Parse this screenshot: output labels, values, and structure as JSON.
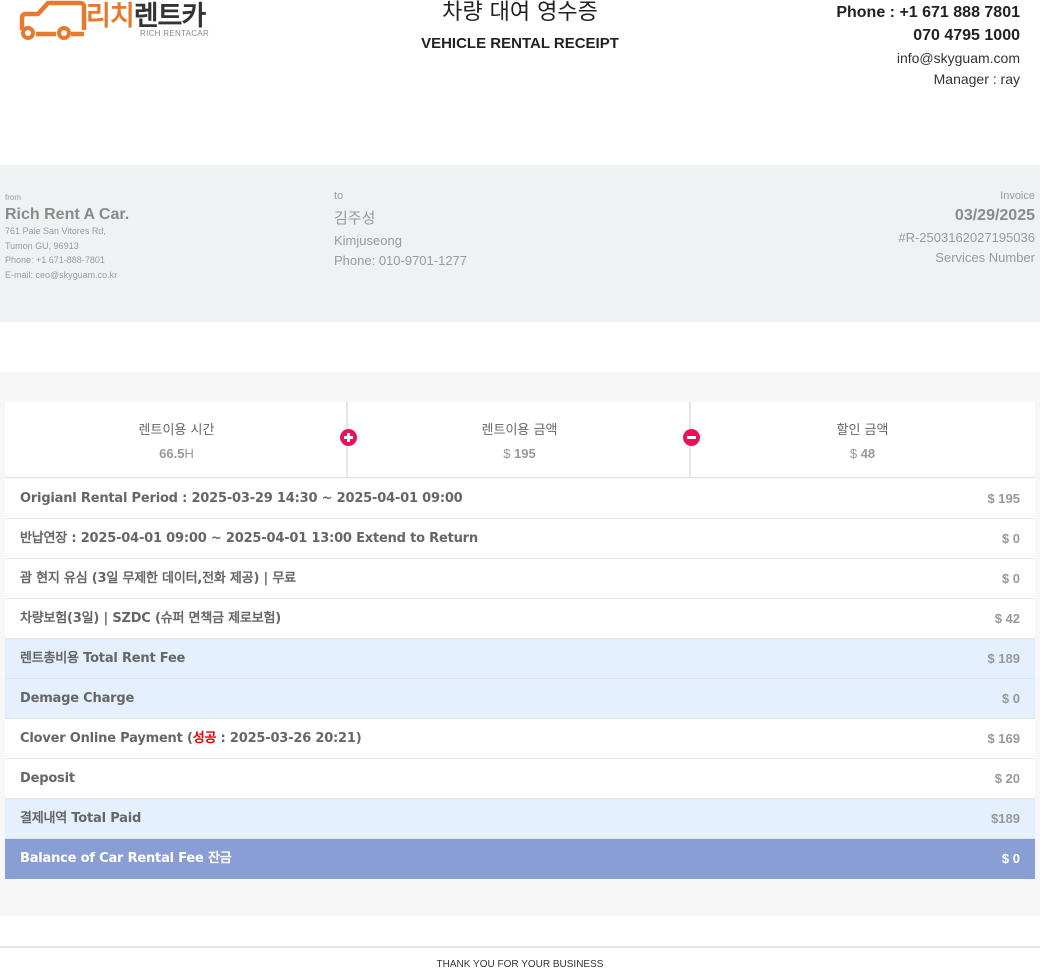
{
  "header": {
    "logo_kr_1": "리치",
    "logo_kr_2": "렌트카",
    "logo_en": "RICH RENTACAR",
    "brand_color": "#e8782b",
    "title_kr": "차량 대여 영수증",
    "title_en": "VEHICLE RENTAL RECEIPT",
    "phone1": "Phone : +1 671 888 7801",
    "phone2": "070 4795 1000",
    "email": "info@skyguam.com",
    "manager": "Manager : ray"
  },
  "from": {
    "label": "from",
    "name": "Rich Rent A Car.",
    "address1": "761 Pale San Vitores Rd,",
    "address2": "Tumon GU, 96913",
    "phone": "Phone: +1 671-888-7801",
    "email": "E-mail: ceo@skyguam.co.kr"
  },
  "to": {
    "label": "to",
    "name_kr": "김주성",
    "name_en": "Kimjuseong",
    "phone": "Phone: 010-9701-1277"
  },
  "invoice": {
    "label": "Invoice",
    "date": "03/29/2025",
    "number": "#R-2503162027195036",
    "services": "Services Number"
  },
  "summary": {
    "time_label": "렌트이용 시간",
    "time_value": "66.5",
    "time_unit": "H",
    "amount_label": "렌트이용 금액",
    "amount_currency": "$",
    "amount_value": "195",
    "discount_label": "할인 금액",
    "discount_currency": "$",
    "discount_value": "48",
    "icon_color": "#e8115c"
  },
  "rows": {
    "r1_label": "Origianl Rental Period : 2025-03-29 14:30 ~ 2025-04-01 09:00",
    "r1_value": "$ 195",
    "r2_label": "반납연장 : 2025-04-01 09:00 ~ 2025-04-01 13:00 Extend to Return",
    "r2_value": "$ 0",
    "r3_label": "괌 현지 유심 (3일 무제한 데이터,전화 제공) | 무료",
    "r3_value": "$ 0",
    "r4_label": "차량보험(3일) | SZDC (슈퍼 면책금 제로보험)",
    "r4_value": "$ 42",
    "r5_label": "렌트총비용 Total Rent Fee",
    "r5_value": "$ 189",
    "r6_label": "Demage Charge",
    "r6_value": "$ 0",
    "r7_label_pre": "Clover Online Payment (",
    "r7_label_ok": "성공",
    "r7_label_post": " : 2025-03-26 20:21)",
    "r7_value": "$ 169",
    "r8_label": "Deposit",
    "r8_value": "$ 20",
    "r9_label": "결제내역 Total Paid",
    "r9_value": "$189",
    "r10_label": "Balance of Car Rental Fee 잔금",
    "r10_value": "$ 0"
  },
  "footer": {
    "text": "THANK YOU FOR YOUR BUSINESS"
  }
}
